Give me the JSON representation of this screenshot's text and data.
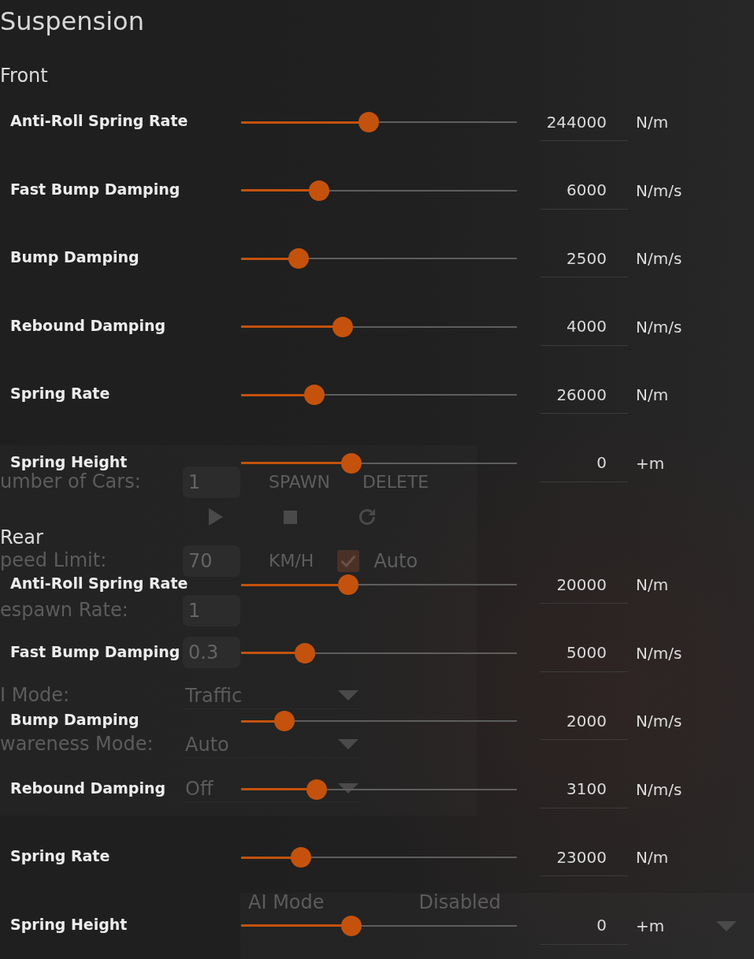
{
  "title": "Suspension",
  "sections": [
    {
      "title": "Front",
      "settings": [
        {
          "label": "Anti-Roll Spring Rate",
          "level": 0.463,
          "value": "244000",
          "unit": "N/m"
        },
        {
          "label": "Fast Bump Damping",
          "level": 0.283,
          "value": "6000",
          "unit": "N/m/s"
        },
        {
          "label": "Bump Damping",
          "level": 0.209,
          "value": "2500",
          "unit": "N/m/s"
        },
        {
          "label": "Rebound Damping",
          "level": 0.369,
          "value": "4000",
          "unit": "N/m/s"
        },
        {
          "label": "Spring Rate",
          "level": 0.266,
          "value": "26000",
          "unit": "N/m"
        },
        {
          "label": "Spring Height",
          "level": 0.4,
          "value": "0",
          "unit": "+m"
        }
      ]
    },
    {
      "title": "Rear",
      "settings": [
        {
          "label": "Anti-Roll Spring Rate",
          "level": 0.389,
          "value": "20000",
          "unit": "N/m"
        },
        {
          "label": "Fast Bump Damping",
          "level": 0.231,
          "value": "5000",
          "unit": "N/m/s"
        },
        {
          "label": "Bump Damping",
          "level": 0.157,
          "value": "2000",
          "unit": "N/m/s"
        },
        {
          "label": "Rebound Damping",
          "level": 0.274,
          "value": "3100",
          "unit": "N/m/s"
        },
        {
          "label": "Spring Rate",
          "level": 0.217,
          "value": "23000",
          "unit": "N/m"
        },
        {
          "label": "Spring Height",
          "level": 0.4,
          "value": "0",
          "unit": "+m"
        }
      ]
    }
  ],
  "background_window": {
    "rows": [
      {
        "kind": "input",
        "label": "umber of Cars:",
        "value": "1",
        "buttons": [
          "SPAWN",
          "DELETE"
        ]
      },
      {
        "kind": "playback"
      },
      {
        "kind": "input",
        "label": "peed Limit:",
        "value": "70",
        "unit": "KM/H",
        "checkbox": {
          "label": "Auto",
          "checked": true
        }
      },
      {
        "kind": "input",
        "label": "espawn Rate:",
        "value": "1"
      },
      {
        "kind": "input",
        "value": "0.3"
      },
      {
        "kind": "select",
        "label": "I Mode:",
        "value": "Traffic"
      },
      {
        "kind": "select",
        "label": "wareness Mode:",
        "value": "Auto"
      },
      {
        "kind": "select",
        "value": "Off"
      }
    ]
  },
  "background_bar": {
    "label": "AI Mode",
    "value": "Disabled"
  }
}
